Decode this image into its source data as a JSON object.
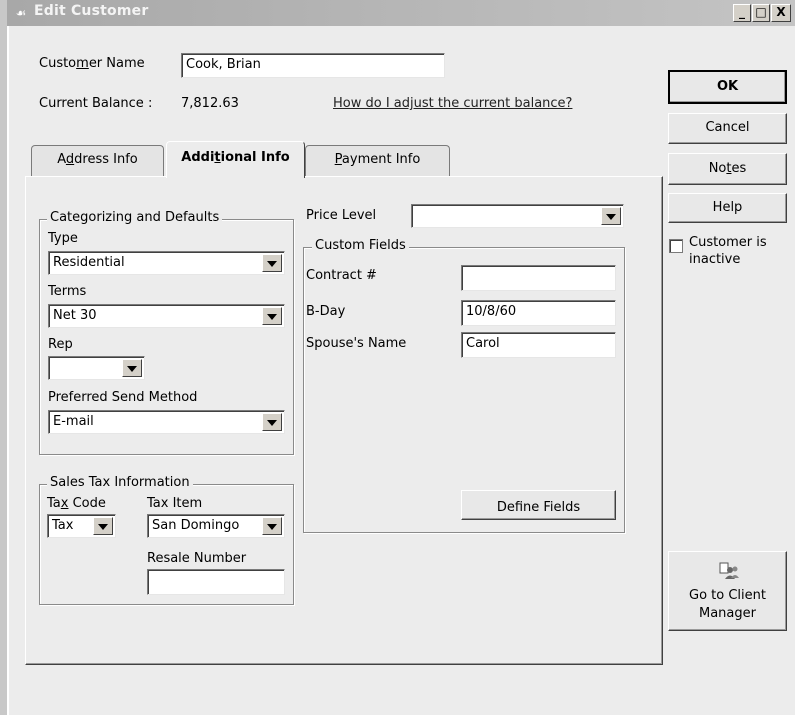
{
  "window": {
    "title": "Edit Customer",
    "caption_buttons": [
      "_",
      "□",
      "X"
    ]
  },
  "header": {
    "customer_name_label": "Customer Name",
    "customer_name_value": "Cook, Brian",
    "balance_label": "Current Balance :",
    "balance_value": "7,812.63",
    "adjust_link": "How do I adjust the current balance?"
  },
  "tabs": [
    {
      "label": "Address Info",
      "active": false
    },
    {
      "label": "Additional Info",
      "active": true
    },
    {
      "label": "Payment Info",
      "active": false
    }
  ],
  "categorizing": {
    "legend": "Categorizing and Defaults",
    "type_label": "Type",
    "type_value": "Residential",
    "terms_label": "Terms",
    "terms_value": "Net 30",
    "rep_label": "Rep",
    "rep_value": "",
    "send_label": "Preferred Send Method",
    "send_value": "E-mail"
  },
  "sales_tax": {
    "legend": "Sales Tax Information",
    "tax_code_label": "Tax Code",
    "tax_code_value": "Tax",
    "tax_item_label": "Tax Item",
    "tax_item_value": "San Domingo",
    "resale_label": "Resale Number",
    "resale_value": ""
  },
  "price_level": {
    "label": "Price Level",
    "value": ""
  },
  "custom_fields": {
    "legend": "Custom Fields",
    "fields": [
      {
        "label": "Contract #",
        "value": ""
      },
      {
        "label": "B-Day",
        "value": "10/8/60"
      },
      {
        "label": "Spouse's Name",
        "value": "Carol"
      }
    ],
    "define_button": "Define Fields"
  },
  "side_buttons": {
    "ok": "OK",
    "cancel": "Cancel",
    "notes": "Notes",
    "help": "Help",
    "inactive_label_1": "Customer is",
    "inactive_label_2": "inactive",
    "inactive_checked": false,
    "client_manager_1": "Go to Client",
    "client_manager_2": "Manager"
  }
}
